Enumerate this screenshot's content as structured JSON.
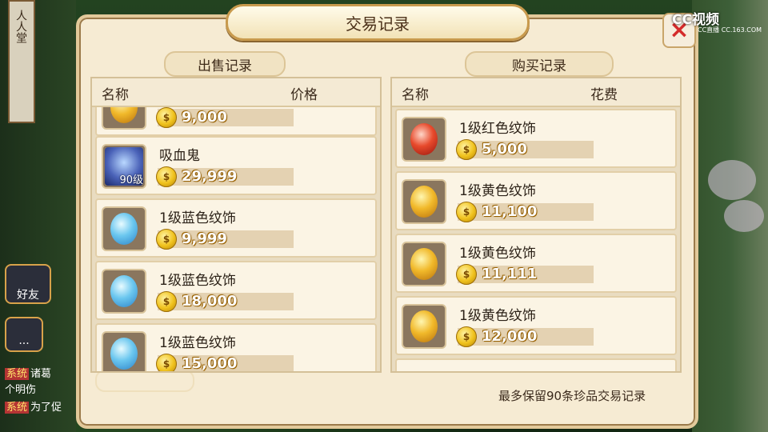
{
  "dialog": {
    "title": "交易记录",
    "close_label": "×",
    "footer_note": "最多保留90条珍品交易记录"
  },
  "watermark": {
    "brand": "CC视频",
    "sub_text": "CC直播  CC.163.COM"
  },
  "sale": {
    "section_label": "出售记录",
    "col_name": "名称",
    "col_value": "价格",
    "rows": [
      {
        "name": "",
        "price": "9,000",
        "icon": "gold-gem-icon"
      },
      {
        "name": "吸血鬼",
        "price": "29,999",
        "icon": "vampire-pet-icon",
        "level": "90级"
      },
      {
        "name": "1级蓝色纹饰",
        "price": "9,999",
        "icon": "blue-gem-icon"
      },
      {
        "name": "1级蓝色纹饰",
        "price": "18,000",
        "icon": "blue-gem-icon"
      },
      {
        "name": "1级蓝色纹饰",
        "price": "15,000",
        "icon": "blue-gem-icon"
      }
    ]
  },
  "purchase": {
    "section_label": "购买记录",
    "col_name": "名称",
    "col_value": "花费",
    "rows": [
      {
        "name": "1级红色纹饰",
        "price": "5,000",
        "icon": "red-gem-icon"
      },
      {
        "name": "1级黄色纹饰",
        "price": "11,100",
        "icon": "gold-gem-icon"
      },
      {
        "name": "1级黄色纹饰",
        "price": "11,111",
        "icon": "gold-gem-icon"
      },
      {
        "name": "1级黄色纹饰",
        "price": "12,000",
        "icon": "gold-gem-icon"
      }
    ]
  },
  "side": {
    "banner_text": "人人堂",
    "friends_label": "好友",
    "chat": [
      {
        "tag": "系统",
        "text": "诸葛"
      },
      {
        "tag": "",
        "text": "个明伤"
      },
      {
        "tag": "系统",
        "text": "为了促"
      }
    ]
  },
  "coin_glyph": "$"
}
